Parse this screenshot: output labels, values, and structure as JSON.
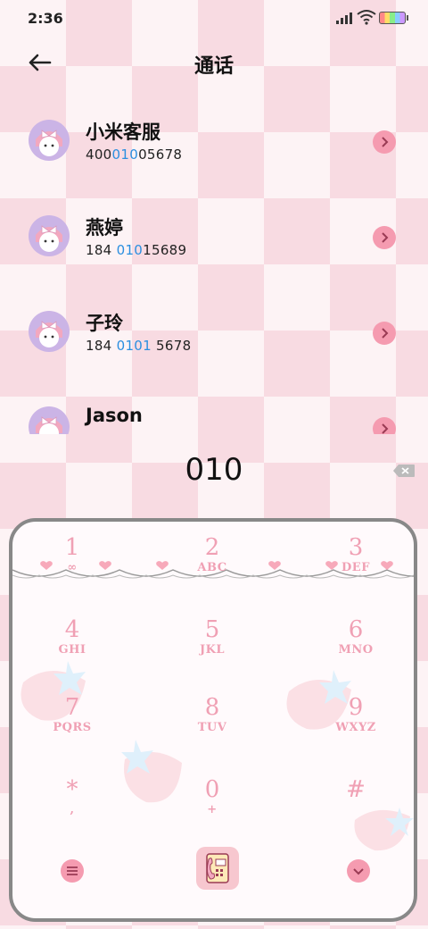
{
  "status_bar": {
    "time": "2:36"
  },
  "header": {
    "title": "通话"
  },
  "contacts": [
    {
      "name": "小米客服",
      "number_parts": [
        "400",
        "010",
        "05678"
      ]
    },
    {
      "name": "燕婷",
      "number_parts": [
        "184 ",
        "010",
        "15689"
      ]
    },
    {
      "name": "子玲",
      "number_parts": [
        "184 ",
        "0101",
        " 5678"
      ]
    },
    {
      "name": "Jason",
      "number_parts": [
        "",
        "",
        ""
      ]
    }
  ],
  "dial_input": {
    "value": "010"
  },
  "keypad": {
    "keys": [
      {
        "digit": "1",
        "letters": "∞"
      },
      {
        "digit": "2",
        "letters": "ABC"
      },
      {
        "digit": "3",
        "letters": "DEF"
      },
      {
        "digit": "4",
        "letters": "GHI"
      },
      {
        "digit": "5",
        "letters": "JKL"
      },
      {
        "digit": "6",
        "letters": "MNO"
      },
      {
        "digit": "7",
        "letters": "PQRS"
      },
      {
        "digit": "8",
        "letters": "TUV"
      },
      {
        "digit": "9",
        "letters": "WXYZ"
      },
      {
        "digit": "*",
        "letters": ","
      },
      {
        "digit": "0",
        "letters": "+"
      },
      {
        "digit": "#",
        "letters": ""
      }
    ]
  },
  "colors": {
    "accent_pink": "#f59bb0",
    "keypad_text": "#f0a0b4",
    "highlight_blue": "#2b8fe0"
  },
  "icons": [
    "back-arrow-icon",
    "chevron-right-icon",
    "backspace-icon",
    "menu-icon",
    "phone-icon",
    "chevron-down-icon"
  ]
}
